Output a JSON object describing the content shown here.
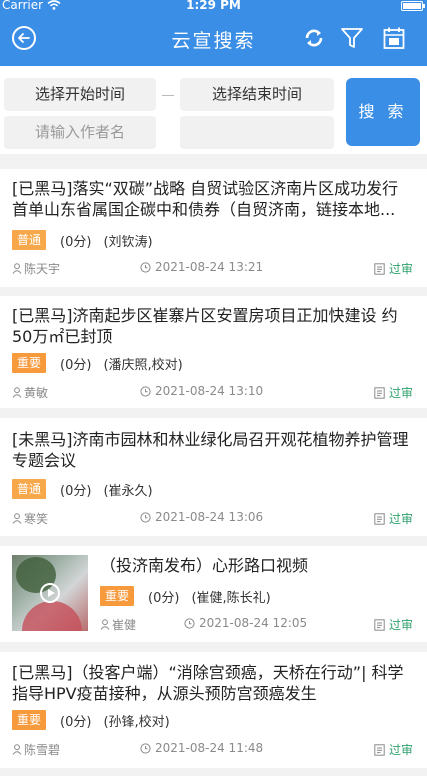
{
  "status_bar": {
    "carrier": "Carrier",
    "time": "1:29 PM"
  },
  "nav": {
    "title": "云宣搜索",
    "back_icon": "back-circle-icon",
    "refresh_icon": "refresh-icon",
    "filter_icon": "filter-icon",
    "calendar_icon": "calendar-month-icon",
    "accent": "#3a8ee6"
  },
  "search": {
    "start_time_placeholder": "选择开始时间",
    "end_time_placeholder": "选择结束时间",
    "author_placeholder": "请输入作者名",
    "extra_field_value": "",
    "button_label": "搜 索"
  },
  "items": [
    {
      "headline": "[已黑马]落实“双碳”战略 自贸试验区济南片区成功发行首单山东省属国企碳中和债券（自贸济南，链接本地...",
      "level": "普通",
      "score": "(0分)",
      "editors": "(刘钦涛)",
      "author": "陈天宇",
      "datetime": "2021-08-24 13:21",
      "review": "过审"
    },
    {
      "headline": "[已黑马]济南起步区崔寨片区安置房项目正加快建设 约50万㎡已封顶",
      "level": "重要",
      "score": "(0分)",
      "editors": "(潘庆照,校对)",
      "author": "黄敏",
      "datetime": "2021-08-24 13:10",
      "review": "过审"
    },
    {
      "headline": "[未黑马]济南市园林和林业绿化局召开观花植物养护管理专题会议",
      "level": "普通",
      "score": "(0分)",
      "editors": "(崔永久)",
      "author": "寒笑",
      "datetime": "2021-08-24 13:06",
      "review": "过审"
    },
    {
      "headline": "（投济南发布）心形路口视频",
      "level": "重要",
      "score": "(0分)",
      "editors": "(崔健,陈长礼)",
      "author": "崔健",
      "datetime": "2021-08-24 12:05",
      "review": "过审"
    },
    {
      "headline": "[已黑马]（投客户端）“消除宫颈癌，天桥在行动”| 科学指导HPV疫苗接种，从源头预防宫颈癌发生",
      "level": "重要",
      "score": "(0分)",
      "editors": "(孙锋,校对)",
      "author": "陈雪碧",
      "datetime": "2021-08-24 11:48",
      "review": "过审"
    }
  ]
}
